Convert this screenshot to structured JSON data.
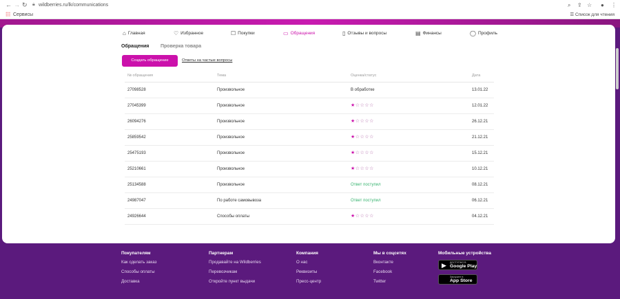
{
  "browser": {
    "url": "wildberries.ru/lk/communications",
    "bookmarks": {
      "apps_label": "Сервисы",
      "reading_list": "Список для чтения"
    }
  },
  "nav": [
    {
      "label": "Главная",
      "icon": "home-icon",
      "glyph": "⌂"
    },
    {
      "label": "Избранное",
      "icon": "heart-icon",
      "glyph": "♡"
    },
    {
      "label": "Покупки",
      "icon": "bag-icon",
      "glyph": "☐"
    },
    {
      "label": "Обращения",
      "icon": "message-icon",
      "glyph": "▭",
      "active": true
    },
    {
      "label": "Отзывы и вопросы",
      "icon": "reviews-icon",
      "glyph": "▯"
    },
    {
      "label": "Финансы",
      "icon": "wallet-icon",
      "glyph": "▤"
    },
    {
      "label": "Профиль",
      "icon": "profile-icon",
      "glyph": "◯"
    }
  ],
  "subtabs": {
    "active": "Обращения",
    "inactive": "Проверка товара"
  },
  "actions": {
    "create": "Создать обращение",
    "faq": "Ответы на частые вопросы"
  },
  "table": {
    "headers": [
      "№ обращения",
      "Тема",
      "Оценка/статус",
      "Дата"
    ],
    "rows": [
      {
        "id": "27098528",
        "topic": "Произвольное",
        "status": "В обработке",
        "rating": null,
        "date": "13.01.22"
      },
      {
        "id": "27045399",
        "topic": "Произвольное",
        "status": "",
        "rating": 1,
        "date": "12.01.22"
      },
      {
        "id": "26094276",
        "topic": "Произвольное",
        "status": "",
        "rating": 1,
        "date": "26.12.21"
      },
      {
        "id": "25859542",
        "topic": "Произвольное",
        "status": "",
        "rating": 1,
        "date": "21.12.21"
      },
      {
        "id": "25475193",
        "topic": "Произвольное",
        "status": "",
        "rating": 1,
        "date": "15.12.21"
      },
      {
        "id": "25210661",
        "topic": "Произвольное",
        "status": "",
        "rating": 1,
        "date": "10.12.21"
      },
      {
        "id": "25134588",
        "topic": "Произвольное",
        "status": "Ответ поступил",
        "rating": null,
        "date": "08.12.21"
      },
      {
        "id": "24987047",
        "topic": "По работе самовывоза",
        "status": "Ответ поступил",
        "rating": null,
        "date": "06.12.21"
      },
      {
        "id": "24926644",
        "topic": "Способы оплаты",
        "status": "",
        "rating": 1,
        "date": "04.12.21"
      }
    ],
    "star_glyph_full": "★",
    "star_glyph_empty": "☆",
    "star_max": 5
  },
  "footer": {
    "columns": [
      {
        "title": "Покупателям",
        "links": [
          "Как сделать заказ",
          "Способы оплаты",
          "Доставка"
        ]
      },
      {
        "title": "Партнерам",
        "links": [
          "Продавайте на Wildberries",
          "Перевозчикам",
          "Откройте пункт выдачи"
        ]
      },
      {
        "title": "Компания",
        "links": [
          "О нас",
          "Реквизиты",
          "Пресс-центр"
        ]
      },
      {
        "title": "Мы в соцсетях",
        "links": [
          "Вконтакте",
          "Facebook",
          "Twitter"
        ]
      }
    ],
    "mobile": {
      "title": "Мобильные устройства",
      "stores": [
        {
          "small": "ДОСТУПНО В",
          "big": "Google Play",
          "icon": "google-play-icon",
          "glyph": "▶"
        },
        {
          "small": "Загрузите в",
          "big": "App Store",
          "icon": "apple-icon",
          "glyph": ""
        }
      ]
    }
  },
  "colors": {
    "brand_magenta": "#cb11ab",
    "footer_purple": "#5b1a7d",
    "status_green": "#37b36f"
  }
}
